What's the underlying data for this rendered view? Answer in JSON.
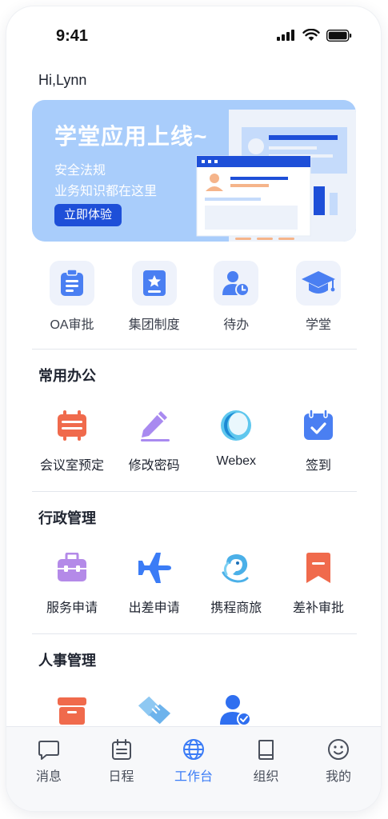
{
  "status": {
    "time": "9:41"
  },
  "greeting": "Hi,Lynn",
  "banner": {
    "title": "学堂应用上线~",
    "line1": "安全法规",
    "line2": "业务知识都在这里",
    "button": "立即体验"
  },
  "quick": [
    {
      "label": "OA审批",
      "icon": "clipboard-icon"
    },
    {
      "label": "集团制度",
      "icon": "star-book-icon"
    },
    {
      "label": "待办",
      "icon": "user-clock-icon"
    },
    {
      "label": "学堂",
      "icon": "graduation-cap-icon"
    }
  ],
  "sections": [
    {
      "title": "常用办公",
      "items": [
        {
          "label": "会议室预定",
          "icon": "meeting-room-icon"
        },
        {
          "label": "修改密码",
          "icon": "pencil-icon"
        },
        {
          "label": "Webex",
          "icon": "webex-icon"
        },
        {
          "label": "签到",
          "icon": "calendar-check-icon"
        }
      ]
    },
    {
      "title": "行政管理",
      "items": [
        {
          "label": "服务申请",
          "icon": "briefcase-icon"
        },
        {
          "label": "出差申请",
          "icon": "airplane-icon"
        },
        {
          "label": "携程商旅",
          "icon": "dolphin-icon"
        },
        {
          "label": "差补审批",
          "icon": "bookmark-icon"
        }
      ]
    },
    {
      "title": "人事管理",
      "items": [
        {
          "icon": "archive-box-icon"
        },
        {
          "icon": "handshake-icon"
        },
        {
          "icon": "user-verified-icon"
        }
      ]
    }
  ],
  "tabs": [
    {
      "label": "消息",
      "icon": "message-icon",
      "active": false
    },
    {
      "label": "日程",
      "icon": "calendar-icon",
      "active": false
    },
    {
      "label": "工作台",
      "icon": "globe-icon",
      "active": true
    },
    {
      "label": "组织",
      "icon": "book-icon",
      "active": false
    },
    {
      "label": "我的",
      "icon": "smiley-icon",
      "active": false
    }
  ],
  "colors": {
    "accent": "#3b7cf6",
    "banner": "#a9cdfb",
    "button": "#1e4fd8",
    "orange": "#f06a4c",
    "purple": "#a98af0"
  }
}
